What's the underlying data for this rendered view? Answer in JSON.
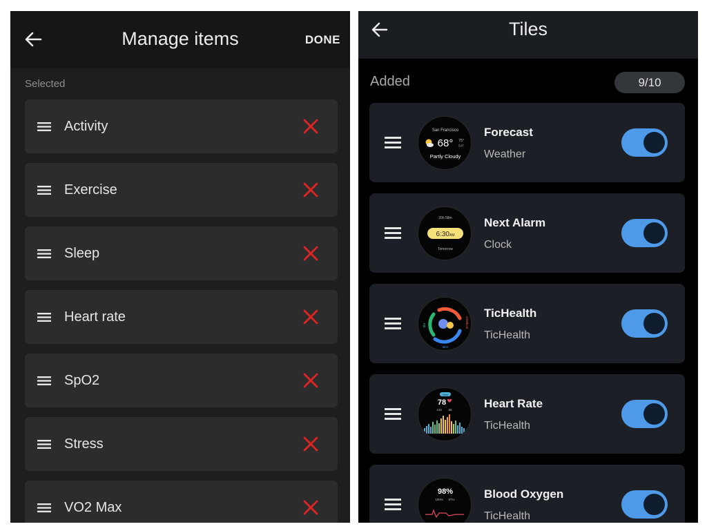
{
  "manage": {
    "title": "Manage items",
    "done_label": "DONE",
    "section_label": "Selected",
    "items": [
      {
        "label": "Activity"
      },
      {
        "label": "Exercise"
      },
      {
        "label": "Sleep"
      },
      {
        "label": "Heart rate"
      },
      {
        "label": "SpO2"
      },
      {
        "label": "Stress"
      },
      {
        "label": "VO2 Max"
      }
    ],
    "icons": {
      "back": "back-arrow-icon",
      "drag": "drag-handle-icon",
      "remove": "close-x-icon"
    },
    "colors": {
      "remove": "#e02424",
      "background": "#1e1e1e",
      "item": "#2c2c2c"
    }
  },
  "tiles": {
    "title": "Tiles",
    "section_label": "Added",
    "count": "9/10",
    "items": [
      {
        "name": "Forecast",
        "subtitle": "Weather",
        "enabled": true,
        "preview": {
          "city": "San Francisco",
          "temp": "68°",
          "high": "75°",
          "low": "54°",
          "condition": "Partly Cloudy"
        }
      },
      {
        "name": "Next Alarm",
        "subtitle": "Clock",
        "enabled": true,
        "preview": {
          "top": "20h 58m",
          "time": "6:30",
          "ampm": "AM",
          "bottom": "Tomorrow"
        }
      },
      {
        "name": "TicHealth",
        "subtitle": "TicHealth",
        "enabled": true,
        "preview": {
          "left": "8hr",
          "right": "2200kcal",
          "bottom": "5km"
        }
      },
      {
        "name": "Heart Rate",
        "subtitle": "TicHealth",
        "enabled": true,
        "preview": {
          "pill": "Now",
          "bpm": "78",
          "max": "143",
          "min": "58"
        }
      },
      {
        "name": "Blood Oxygen",
        "subtitle": "TicHealth",
        "enabled": true,
        "preview": {
          "value": "98%",
          "max": "100%",
          "min": "97%"
        }
      }
    ],
    "colors": {
      "toggle_on": "#4e9ae8",
      "toggle_knob": "#0f1d2e",
      "card": "#1c2026"
    }
  }
}
